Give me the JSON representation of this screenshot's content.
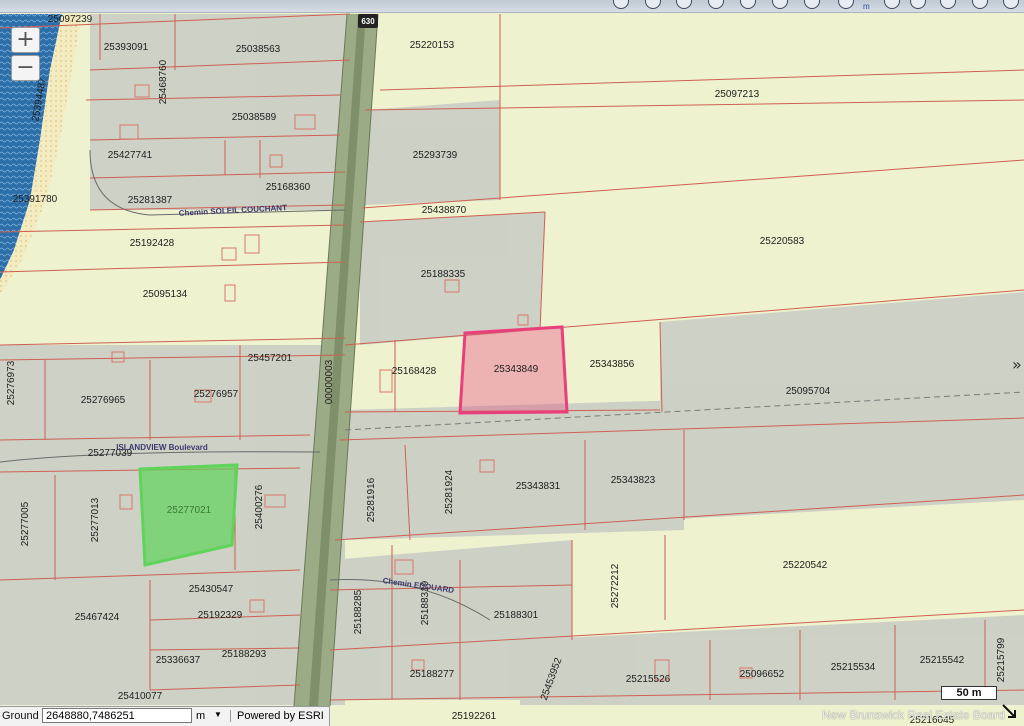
{
  "map": {
    "parcels": [
      "25097239",
      "25393091",
      "25038563",
      "25394487",
      "25468760",
      "25038589",
      "25427741",
      "25281387",
      "25168360",
      "25391780",
      "25220153",
      "25097213",
      "25293739",
      "25438870",
      "25192428",
      "25188335",
      "25220583",
      "25095134",
      "25276973",
      "25276965",
      "25276957",
      "25457201",
      "25168428",
      "25343849",
      "25343856",
      "25095704",
      "25277039",
      "25277021",
      "25277005",
      "25277013",
      "25400276",
      "25281916",
      "25281924",
      "25343831",
      "25343823",
      "25272212",
      "25220542",
      "25188285",
      "25188319",
      "25188301",
      "25430547",
      "25467424",
      "25192329",
      "25336637",
      "25188293",
      "25410077",
      "25188277",
      "25453952",
      "25215526",
      "25096652",
      "25215534",
      "25215542",
      "25215799",
      "25192261",
      "25216045"
    ],
    "road_code": "00000003",
    "route_shield": "630",
    "streets": [
      "Chemin SOLEIL COUCHANT",
      "ISLANDVIEW Boulevard",
      "Chemin EDOUARD"
    ],
    "highlighted_parcels": {
      "pink": "25343849",
      "green": "25277021"
    },
    "colors": {
      "parcel_fill": "#eef2cf",
      "parcel_line": "#cf5f52",
      "highway": "#9bab86",
      "water": "#2c6ea8",
      "pink": "#e9407c",
      "green": "#5fd35a"
    }
  },
  "controls": {
    "zoom_in": "+",
    "zoom_out": "−"
  },
  "toolbar": {
    "measure_unit_label": "m"
  },
  "status": {
    "ground_label": "Ground",
    "coords": "2648880,7486251",
    "unit": "m",
    "powered_by": "Powered by ESRI"
  },
  "scale": {
    "label": "50 m"
  },
  "watermark": "New Brunswick Real Estate Board"
}
